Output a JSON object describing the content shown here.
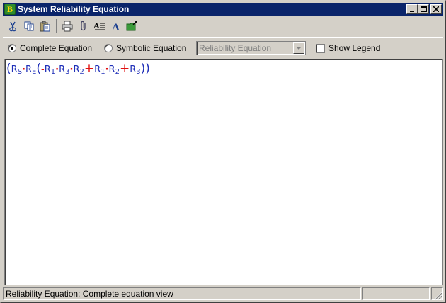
{
  "window": {
    "title": "System Reliability Equation",
    "app_icon_letter": "B"
  },
  "toolbar": {
    "buttons": [
      {
        "name": "cut-icon"
      },
      {
        "name": "copy-icon"
      },
      {
        "name": "paste-icon"
      },
      {
        "name": "print-icon"
      },
      {
        "name": "attach-icon"
      },
      {
        "name": "text-format-icon"
      },
      {
        "name": "font-icon"
      },
      {
        "name": "export-icon"
      }
    ]
  },
  "options": {
    "complete_label": "Complete Equation",
    "symbolic_label": "Symbolic Equation",
    "selected_mode": "complete",
    "combo_value": "Reliability Equation",
    "combo_enabled": false,
    "legend_label": "Show Legend",
    "legend_checked": false
  },
  "equation": {
    "text": "(RS·RE(-R1·R3·R2+R1·R2+R3))",
    "tokens": {
      "rs": "R",
      "rs_sub": "S",
      "re": "R",
      "re_sub": "E",
      "minus": "-",
      "r1a": "R",
      "r1a_sub": "1",
      "r3a": "R",
      "r3a_sub": "3",
      "r2a": "R",
      "r2a_sub": "2",
      "plus1": "+",
      "r1b": "R",
      "r1b_sub": "1",
      "r2b": "R",
      "r2b_sub": "2",
      "plus2": "+",
      "r3b": "R",
      "r3b_sub": "3"
    },
    "colors": {
      "variable": "#1f2fb8",
      "operator": "#e01010"
    }
  },
  "status": {
    "text": "Reliability Equation: Complete equation view",
    "cell2": "",
    "cell3": ""
  }
}
